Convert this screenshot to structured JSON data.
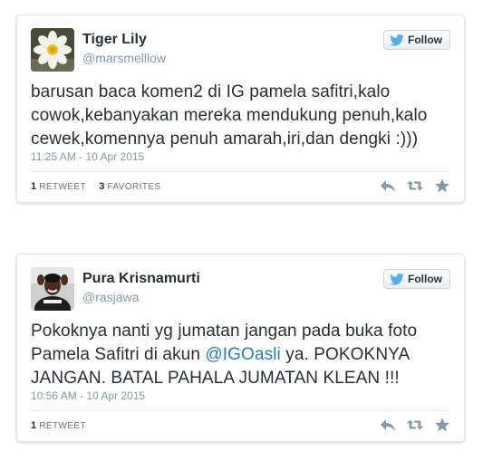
{
  "tweets": [
    {
      "name": "Tiger Lily",
      "handle": "@marsmelllow",
      "follow_label": "Follow",
      "text": "barusan baca komen2 di IG pamela safitri,kalo cowok,kebanyakan mereka mendukung penuh,kalo cewek,komennya penuh amarah,iri,dan dengki :)))",
      "timestamp": "11:25 AM - 10 Apr 2015",
      "retweets_count": "1",
      "retweets_label": "RETWEET",
      "favorites_count": "3",
      "favorites_label": "FAVORITES"
    },
    {
      "name": "Pura Krisnamurti",
      "handle": "@rasjawa",
      "follow_label": "Follow",
      "text_part1": "Pokoknya nanti yg jumatan jangan pada buka foto Pamela Safitri di akun ",
      "mention": "@IGOasli",
      "text_part2": " ya. POKOKNYA JANGAN. BATAL PAHALA JUMATAN KLEAN !!!",
      "timestamp": "10:56 AM - 10 Apr 2015",
      "retweets_count": "1",
      "retweets_label": "RETWEET"
    }
  ],
  "icons": {
    "bird": "twitter-bird-icon",
    "reply": "reply-icon",
    "retweet": "retweet-icon",
    "favorite": "star-icon"
  },
  "colors": {
    "twitter_blue": "#55acee",
    "link": "#2b7bb9",
    "icon_gray": "#8899a6"
  }
}
